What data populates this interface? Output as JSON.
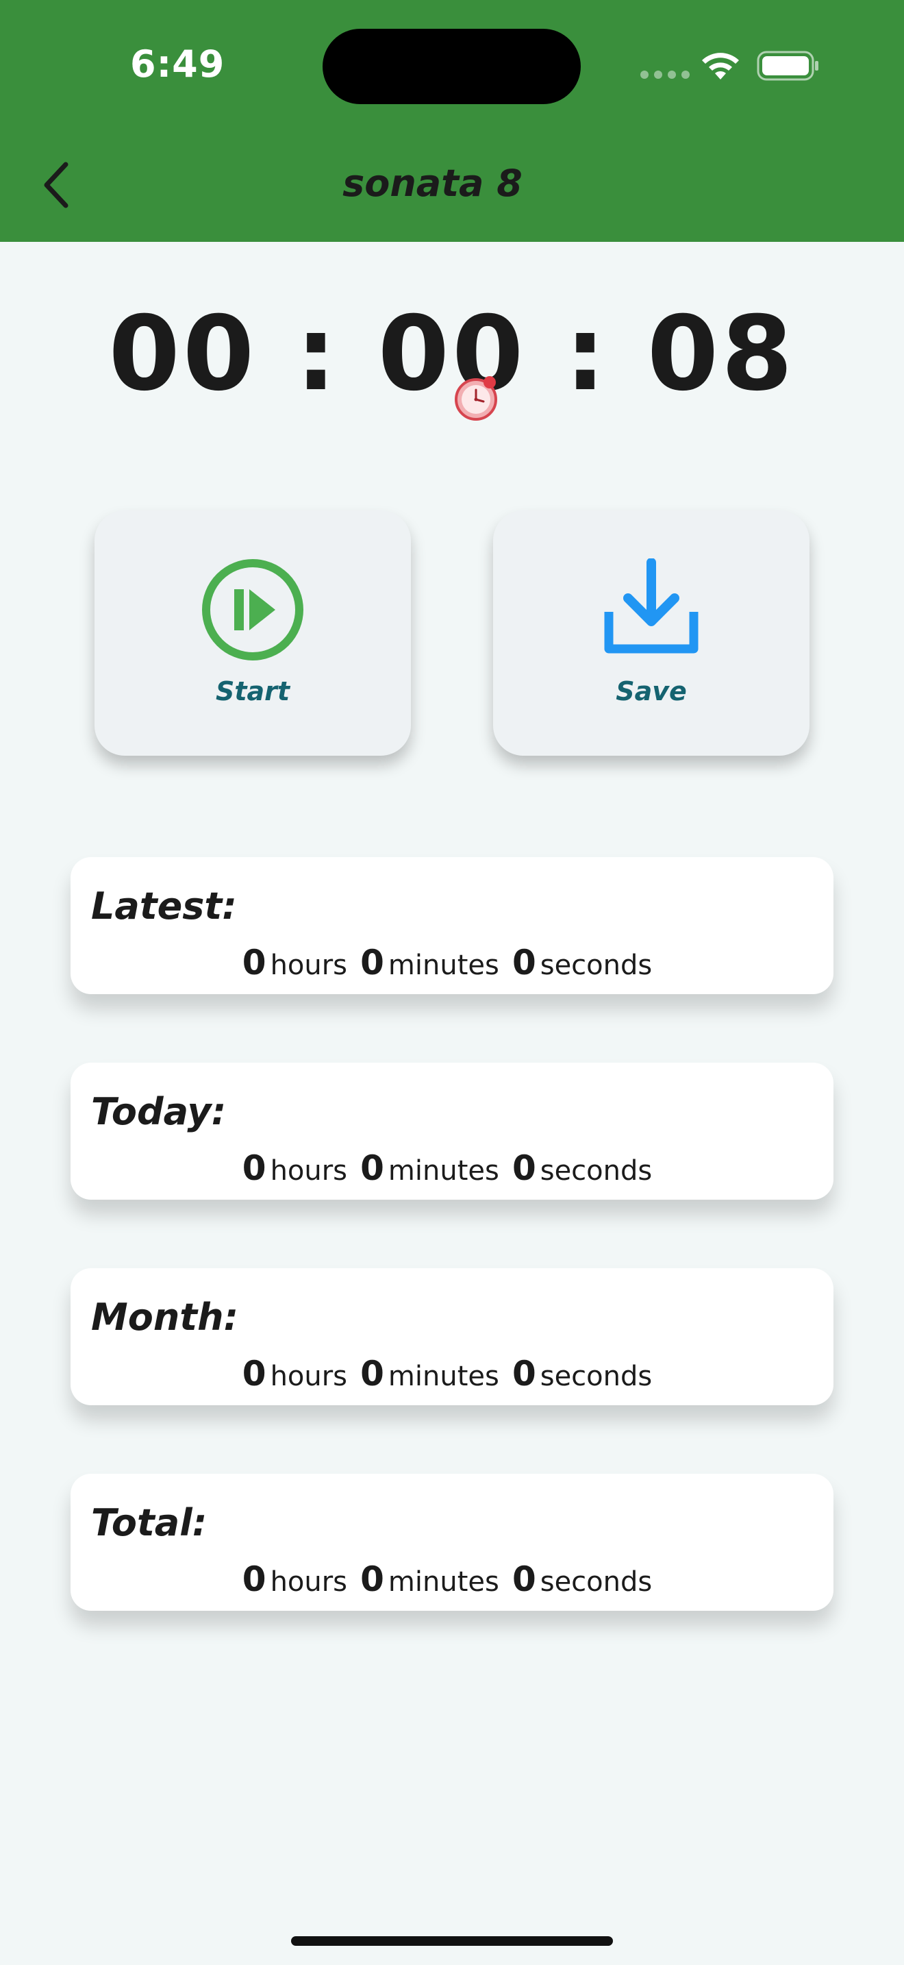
{
  "status_bar": {
    "time": "6:49"
  },
  "nav": {
    "title": "sonata 8",
    "back_icon": "chevron-left-icon"
  },
  "timer": {
    "display": "00 : 00 : 08"
  },
  "actions": [
    {
      "label": "Start",
      "icon": "play-circle-icon",
      "color": "#4caf50"
    },
    {
      "label": "Save",
      "icon": "download-icon",
      "color": "#2196f3"
    }
  ],
  "stats": [
    {
      "title": "Latest:",
      "hours": "0",
      "minutes": "0",
      "seconds": "0"
    },
    {
      "title": "Today:",
      "hours": "0",
      "minutes": "0",
      "seconds": "0"
    },
    {
      "title": "Month:",
      "hours": "0",
      "minutes": "0",
      "seconds": "0"
    },
    {
      "title": "Total:",
      "hours": "0",
      "minutes": "0",
      "seconds": "0"
    }
  ],
  "units": {
    "hours": "hours",
    "minutes": "minutes",
    "seconds": "seconds"
  },
  "colors": {
    "appbar": "#3a8f3c",
    "background": "#f2f7f7",
    "action_label": "#156370"
  }
}
